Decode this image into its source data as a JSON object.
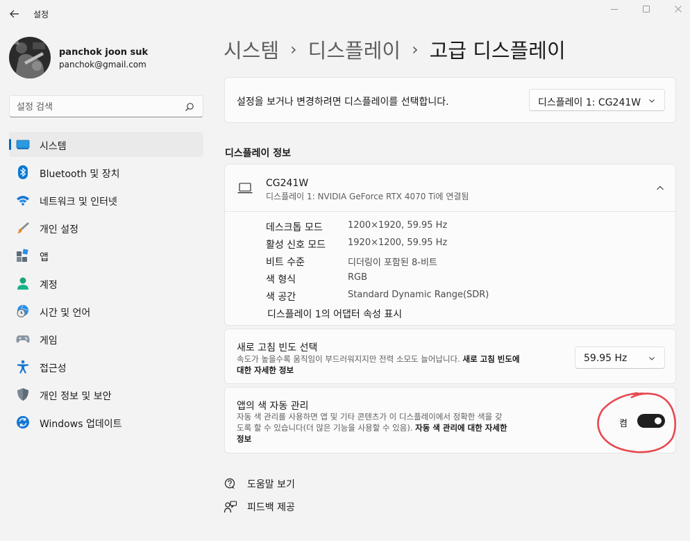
{
  "window": {
    "title": "설정"
  },
  "user": {
    "name": "panchok joon suk",
    "email": "panchok@gmail.com"
  },
  "search": {
    "placeholder": "설정 검색"
  },
  "sidebar": {
    "items": [
      {
        "label": "시스템",
        "icon": "monitor-icon",
        "active": true
      },
      {
        "label": "Bluetooth 및 장치",
        "icon": "bluetooth-icon"
      },
      {
        "label": "네트워크 및 인터넷",
        "icon": "wifi-icon"
      },
      {
        "label": "개인 설정",
        "icon": "brush-icon"
      },
      {
        "label": "앱",
        "icon": "apps-icon"
      },
      {
        "label": "계정",
        "icon": "person-icon"
      },
      {
        "label": "시간 및 언어",
        "icon": "globe-clock-icon"
      },
      {
        "label": "게임",
        "icon": "gamepad-icon"
      },
      {
        "label": "접근성",
        "icon": "accessibility-icon"
      },
      {
        "label": "개인 정보 및 보안",
        "icon": "shield-icon"
      },
      {
        "label": "Windows 업데이트",
        "icon": "update-icon"
      }
    ]
  },
  "breadcrumb": {
    "items": [
      "시스템",
      "디스플레이",
      "고급 디스플레이"
    ],
    "separator": "›"
  },
  "display_select": {
    "text": "설정을 보거나 변경하려면 디스플레이를 선택합니다.",
    "value": "디스플레이 1: CG241W"
  },
  "display_info": {
    "section_title": "디스플레이 정보",
    "name": "CG241W",
    "subtitle": "디스플레이 1: NVIDIA GeForce RTX 4070 Ti에 연결됨",
    "rows": [
      {
        "key": "데스크톱 모드",
        "value": "1200×1920, 59.95 Hz"
      },
      {
        "key": "활성 신호 모드",
        "value": "1920×1200, 59.95 Hz"
      },
      {
        "key": "비트 수준",
        "value": "디더링이 포함된 8-비트"
      },
      {
        "key": "색 형식",
        "value": "RGB"
      },
      {
        "key": "색 공간",
        "value": "Standard Dynamic Range(SDR)"
      }
    ],
    "adapter_link": "디스플레이 1의 어댑터 속성 표시"
  },
  "refresh_rate": {
    "title": "새로 고침 빈도 선택",
    "desc_line1": "속도가 높을수록 움직임이 부드러워지지만 전력 소모도 늘어납니다.",
    "link_part1": "새로 고침 빈도에",
    "link_part2": "대한 자세한 정보",
    "value": "59.95 Hz"
  },
  "auto_color": {
    "title": "앱의 색 자동 관리",
    "desc_line1": "자동 색 관리를 사용하면 앱 및 기타 콘텐츠가 이 디스플레이에서 정확한 색을 갖",
    "desc_line2": "도록 할 수 있습니다(더 많은 기능을 사용할 수 있음).",
    "link_part1": "자동 색 관리에 대한 자세한",
    "link_part2": "정보",
    "toggle_label": "켬",
    "toggle_on": true,
    "highlight_color": "#e8474f"
  },
  "bottom_links": {
    "help": "도움말 보기",
    "feedback": "피드백 제공"
  },
  "colors": {
    "accent": "#0067c0",
    "background": "#f3f3f3",
    "card": "#fbfbfb"
  }
}
